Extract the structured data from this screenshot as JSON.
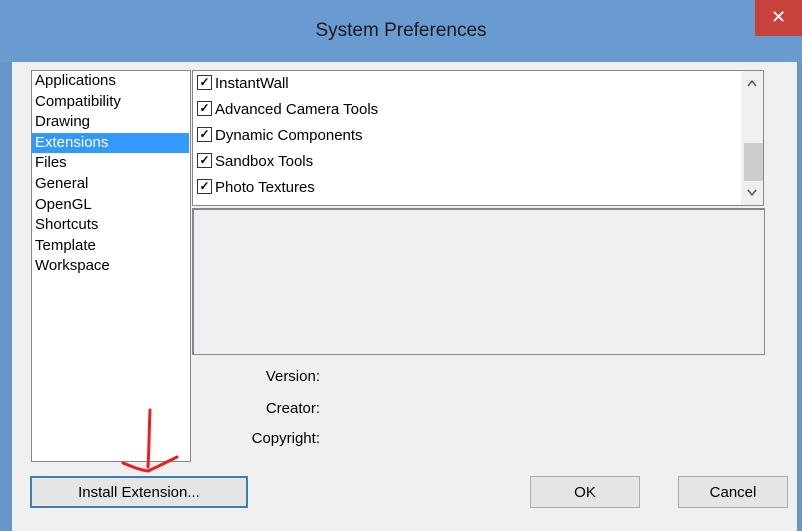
{
  "window": {
    "title": "System Preferences",
    "close_glyph": "✕"
  },
  "sidebar": {
    "items": [
      {
        "label": "Applications",
        "selected": false
      },
      {
        "label": "Compatibility",
        "selected": false
      },
      {
        "label": "Drawing",
        "selected": false
      },
      {
        "label": "Extensions",
        "selected": true
      },
      {
        "label": "Files",
        "selected": false
      },
      {
        "label": "General",
        "selected": false
      },
      {
        "label": "OpenGL",
        "selected": false
      },
      {
        "label": "Shortcuts",
        "selected": false
      },
      {
        "label": "Template",
        "selected": false
      },
      {
        "label": "Workspace",
        "selected": false
      }
    ]
  },
  "extensions": {
    "items": [
      {
        "label": "InstantWall",
        "checked": true
      },
      {
        "label": "Advanced Camera Tools",
        "checked": true
      },
      {
        "label": "Dynamic Components",
        "checked": true
      },
      {
        "label": "Sandbox Tools",
        "checked": true
      },
      {
        "label": "Photo Textures",
        "checked": true
      }
    ]
  },
  "details": {
    "version_label": "Version:",
    "creator_label": "Creator:",
    "copyright_label": "Copyright:"
  },
  "buttons": {
    "install": "Install Extension...",
    "ok": "OK",
    "cancel": "Cancel"
  },
  "colors": {
    "selection": "#3399ff",
    "titlebar": "#6a9bd0",
    "close": "#c8413a",
    "annotation": "#e82020"
  }
}
